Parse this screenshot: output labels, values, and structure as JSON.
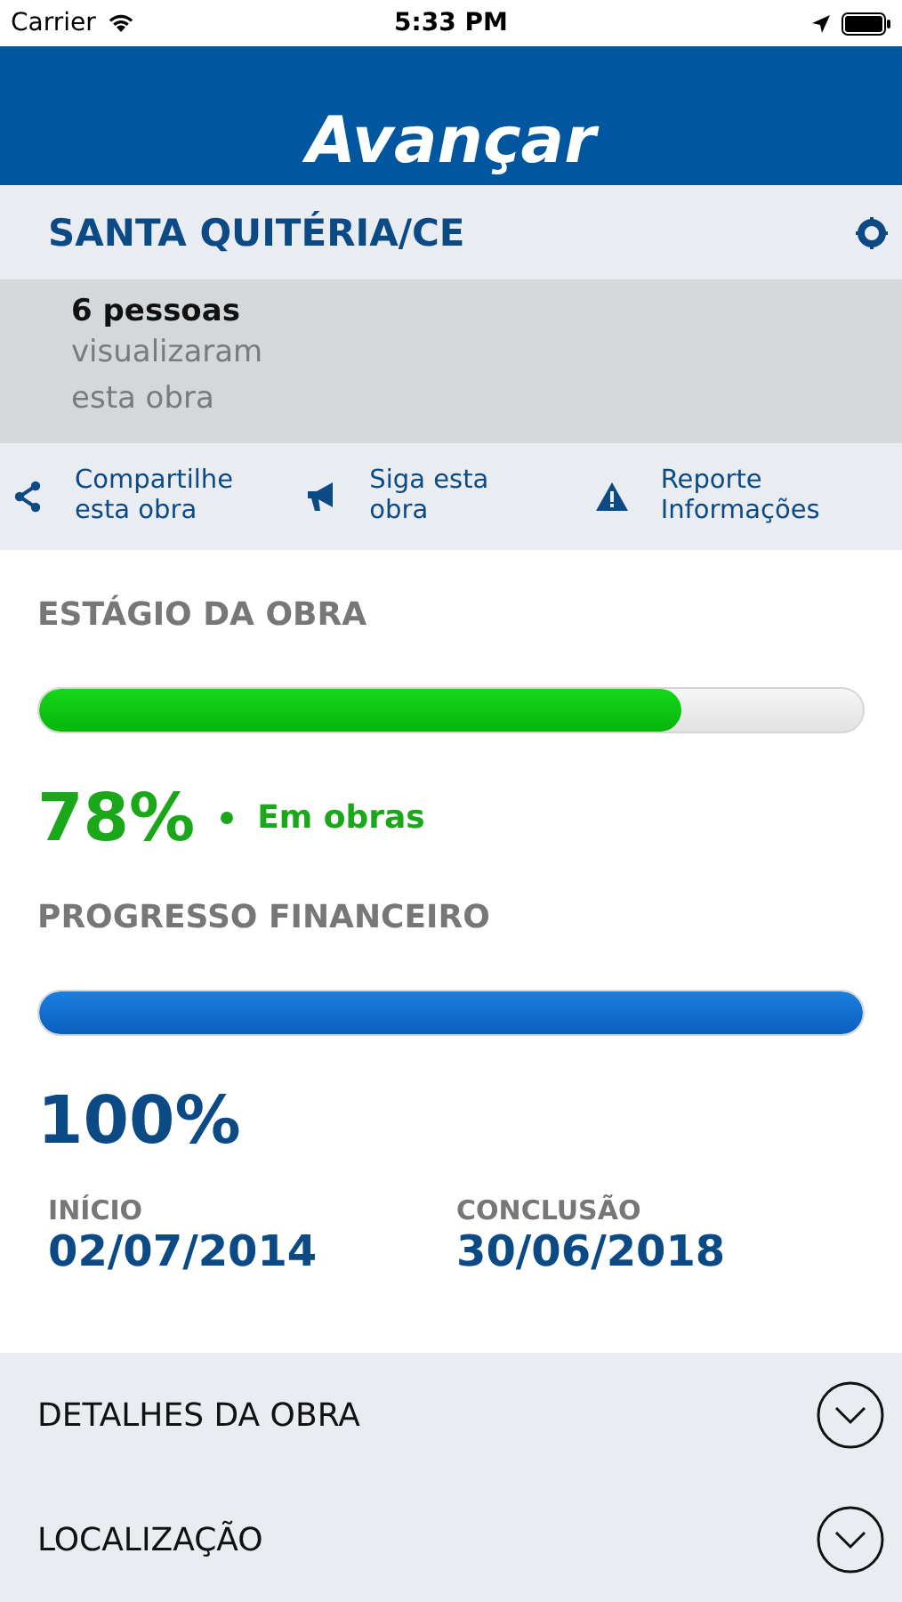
{
  "status_bar": {
    "carrier": "Carrier",
    "time": "5:33 PM"
  },
  "header": {
    "title": "Avançar"
  },
  "project": {
    "name": "SANTA QUITÉRIA/CE"
  },
  "views": {
    "count": "6 pessoas",
    "line_1": "visualizaram",
    "line_2": "esta obra"
  },
  "actions": [
    {
      "kind": "share",
      "line_1": "Compartilhe",
      "line_2": "esta obra"
    },
    {
      "kind": "follow",
      "line_1": "Siga esta",
      "line_2": "obra"
    },
    {
      "kind": "report",
      "line_1": "Reporte",
      "line_2": "Informações"
    }
  ],
  "stage": {
    "label": "ESTÁGIO DA OBRA",
    "level": 0.78,
    "percent": "78%",
    "status": "Em obras"
  },
  "financial": {
    "label": "PROGRESSO FINANCEIRO",
    "level": 1,
    "percent": "100%"
  },
  "dates": [
    {
      "label": "INÍCIO",
      "value": "02/07/2014"
    },
    {
      "label": "CONCLUSÃO",
      "value": "30/06/2018"
    }
  ],
  "sections": [
    {
      "label": "DETALHES DA OBRA",
      "expanded": false
    },
    {
      "label": "LOCALIZAÇÃO",
      "expanded": false
    }
  ]
}
